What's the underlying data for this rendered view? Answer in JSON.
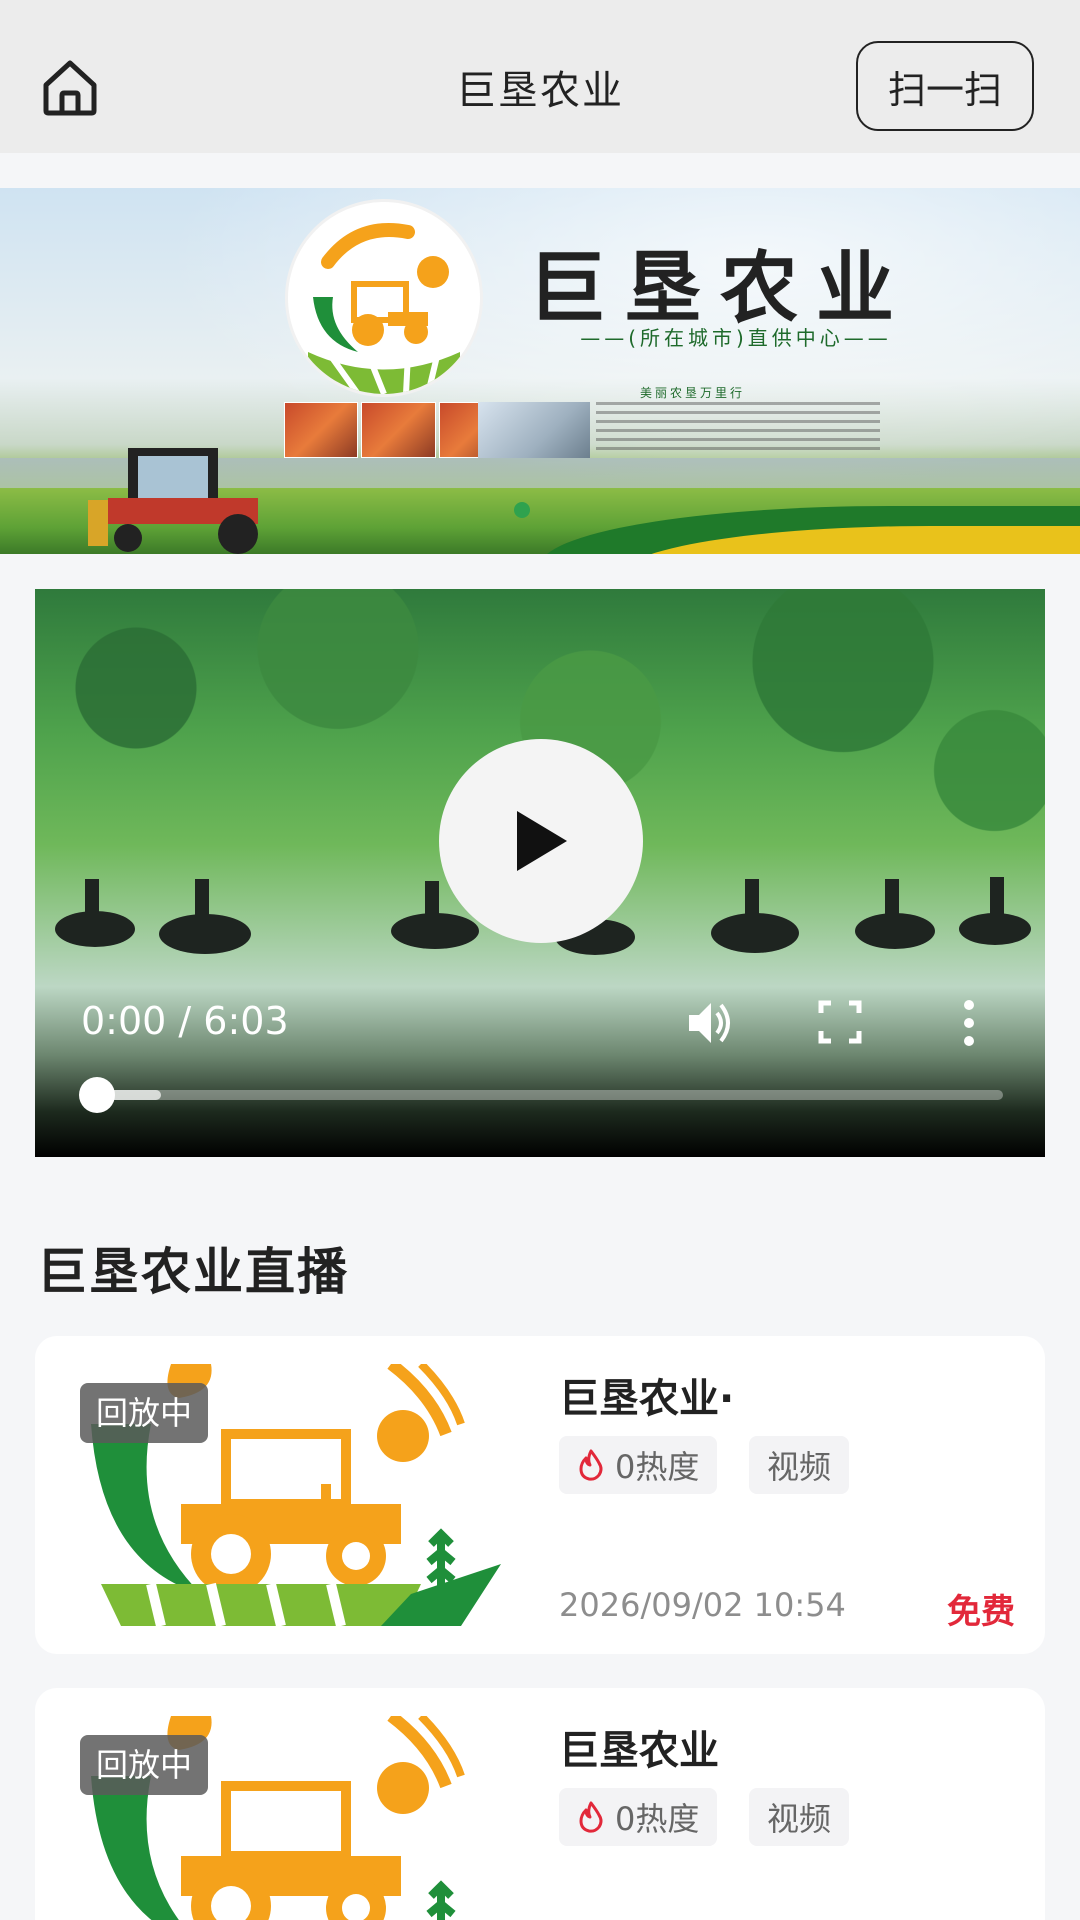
{
  "header": {
    "title": "巨垦农业",
    "scan_label": "扫一扫",
    "home_icon": "home-icon"
  },
  "banner": {
    "brand": "巨垦农业",
    "subtitle": "——(所在城市)直供中心——",
    "mini_title": "美丽农垦万里行",
    "active_slide": 1
  },
  "video": {
    "time": "0:00 / 6:03",
    "progress": 0.0,
    "icons": [
      "play-icon",
      "volume-icon",
      "fullscreen-icon",
      "more-icon"
    ]
  },
  "live": {
    "section_title": "巨垦农业直播",
    "items": [
      {
        "badge": "回放中",
        "title": "巨垦农业·",
        "heat": "0热度",
        "kind": "视频",
        "date": "2026/09/02 10:54",
        "price": "免费"
      },
      {
        "badge": "回放中",
        "title": "巨垦农业",
        "heat": "0热度",
        "kind": "视频"
      }
    ]
  },
  "colors": {
    "accent_green": "#2fa24e",
    "price_red": "#e2283a",
    "logo_orange": "#f5a21b",
    "logo_green": "#1f8f3a"
  }
}
